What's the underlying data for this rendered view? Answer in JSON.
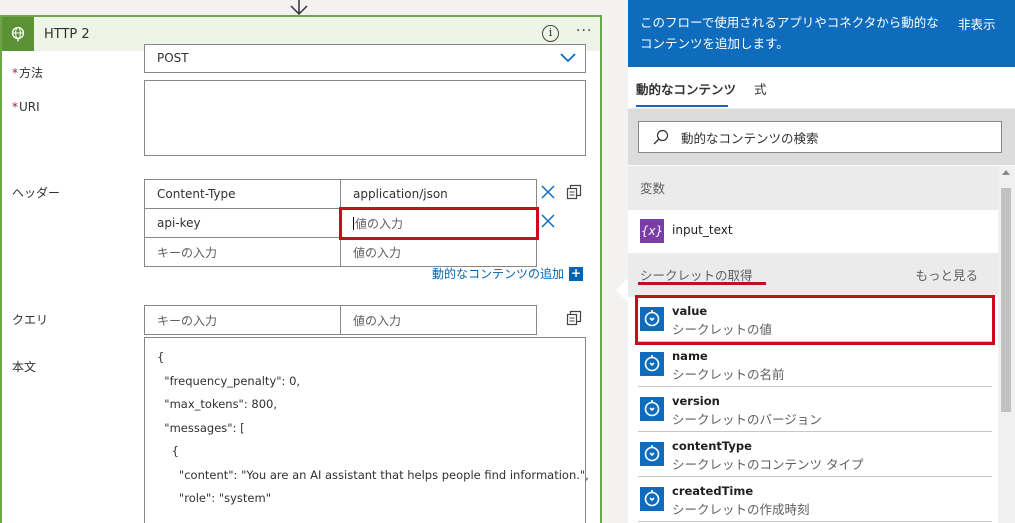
{
  "card": {
    "title": "HTTP 2",
    "more": "···",
    "info": "i",
    "method_label": "方法",
    "method_value": "POST",
    "uri_label": "URI",
    "headers_label": "ヘッダー",
    "headers": [
      {
        "key": "Content-Type",
        "value": "application/json"
      },
      {
        "key": "api-key",
        "value": "値の入力"
      },
      {
        "key": "キーの入力",
        "value": "値の入力"
      }
    ],
    "add_dynamic": "動的なコンテンツの追加",
    "add_plus": "+",
    "query_label": "クエリ",
    "query_key_ph": "キーの入力",
    "query_value_ph": "値の入力",
    "body_label": "本文",
    "body_lines": [
      "{",
      "  \"frequency_penalty\": 0,",
      "  \"max_tokens\": 800,",
      "  \"messages\": [",
      "    {",
      "      \"content\": \"You are an AI assistant that helps people find information.\",",
      "      \"role\": \"system\""
    ]
  },
  "panel": {
    "description": "このフローで使用されるアプリやコネクタから動的なコンテンツを追加します。",
    "hide": "非表示",
    "tabs": [
      "動的なコンテンツ",
      "式"
    ],
    "search_placeholder": "動的なコンテンツの検索",
    "section_variables": "変数",
    "variable_item": "input_text",
    "variable_icon": "{x}",
    "section_secret": "シークレットの取得",
    "see_more": "もっと見る",
    "secret_items": [
      {
        "name": "value",
        "desc": "シークレットの値"
      },
      {
        "name": "name",
        "desc": "シークレットの名前"
      },
      {
        "name": "version",
        "desc": "シークレットのバージョン"
      },
      {
        "name": "contentType",
        "desc": "シークレットのコンテンツ タイプ"
      },
      {
        "name": "createdTime",
        "desc": "シークレットの作成時刻"
      }
    ]
  },
  "colors": {
    "accent": "#0f6cbd",
    "card_border": "#6da54a",
    "highlight": "#c50f1f"
  }
}
